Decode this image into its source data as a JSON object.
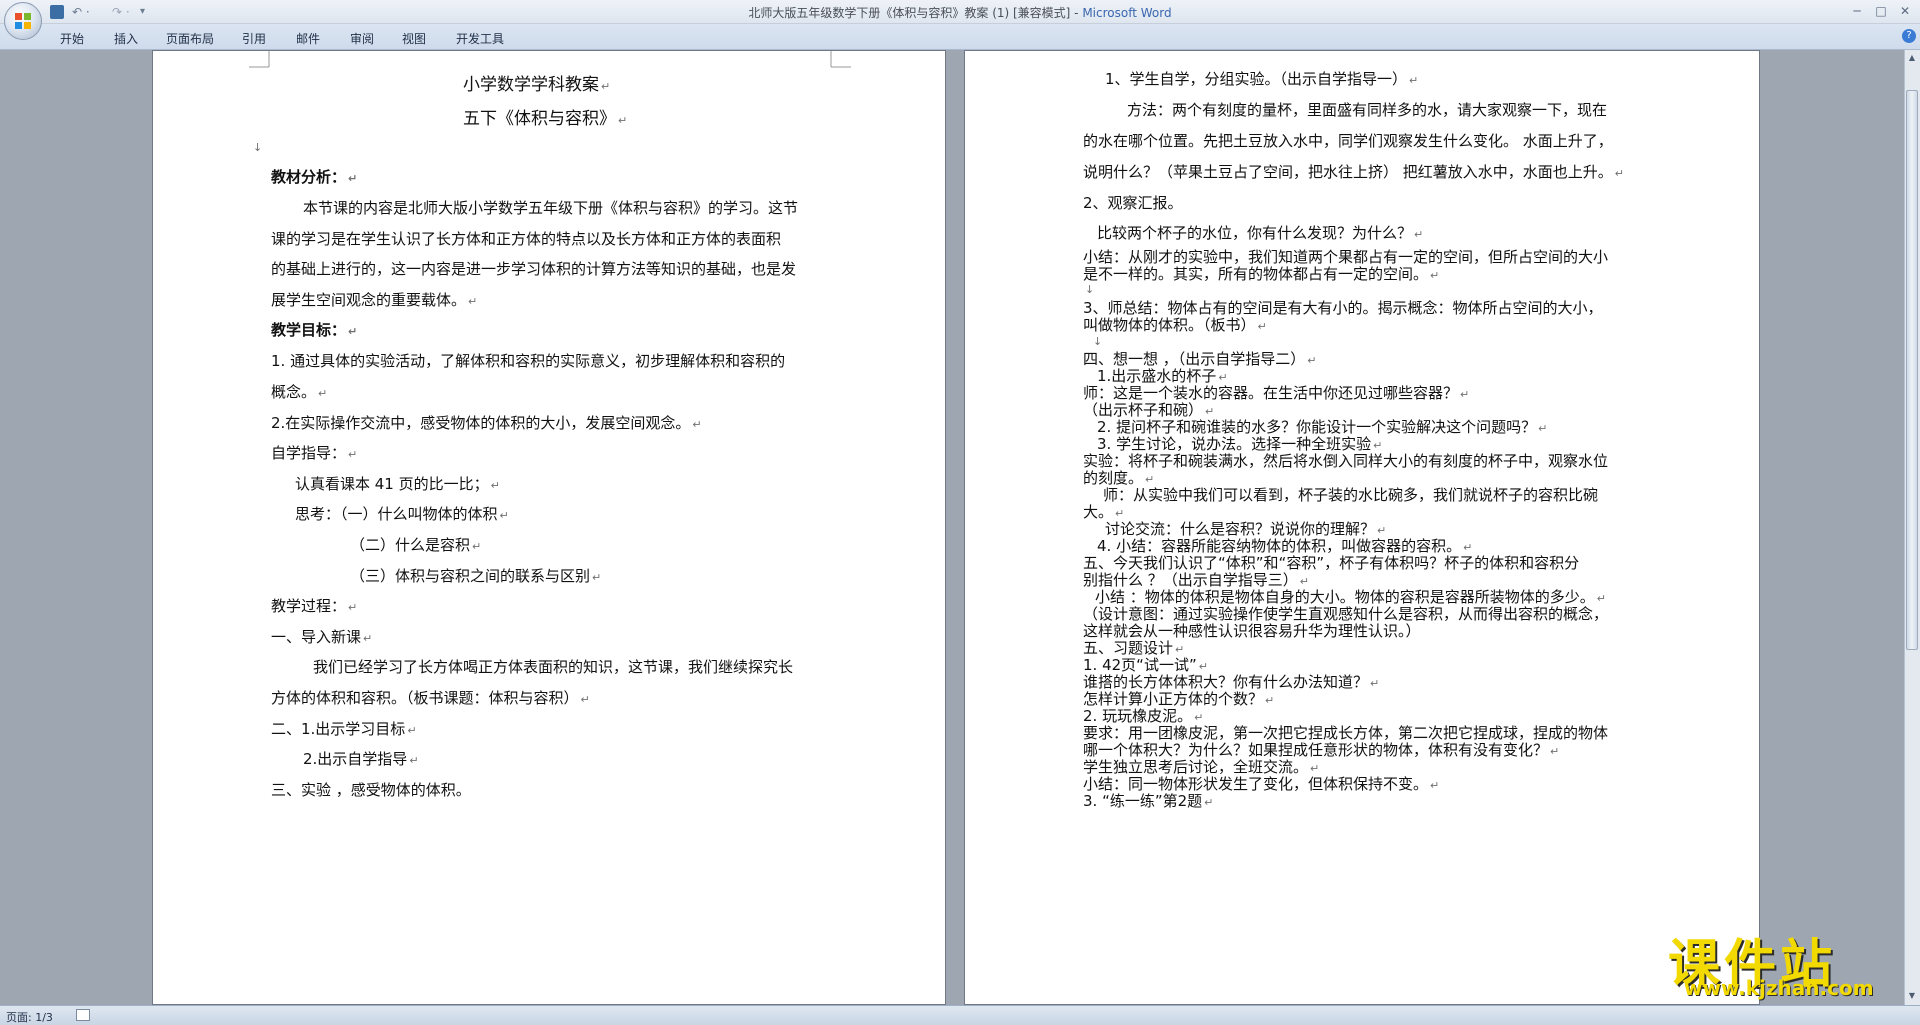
{
  "window": {
    "title_doc": "北师大版五年级数学下册《体积与容积》教案 (1) [兼容模式] - ",
    "title_app": "Microsoft Word"
  },
  "quick_access": {
    "undo": "↶ ·",
    "redo": "↷ ·",
    "more": "▾"
  },
  "ribbon": {
    "tabs": [
      "开始",
      "插入",
      "页面布局",
      "引用",
      "邮件",
      "审阅",
      "视图",
      "开发工具"
    ]
  },
  "page1": {
    "lines": [
      "小学数学学科教案",
      "五下《体积与容积》",
      "",
      "教材分析：",
      "本节课的内容是北师大版小学数学五年级下册《体积与容积》的学习。这节",
      "课的学习是在学生认识了长方体和正方体的特点以及长方体和正方体的表面积",
      "的基础上进行的，这一内容是进一步学习体积的计算方法等知识的基础，也是发",
      "展学生空间观念的重要载体。",
      "教学目标：",
      "1. 通过具体的实验活动，了解体积和容积的实际意义，初步理解体积和容积的",
      "概念。",
      "2.在实际操作交流中，感受物体的体积的大小，发展空间观念。",
      "自学指导：",
      "认真看课本 41 页的比一比；",
      "思考：（一）什么叫物体的体积",
      "（二）什么是容积",
      "（三）体积与容积之间的联系与区别",
      "教学过程：",
      "一、导入新课",
      "我们已经学习了长方体喝正方体表面积的知识，这节课，我们继续探究长",
      "方体的体积和容积。（板书课题：体积与容积）",
      "二、1.出示学习目标",
      "2.出示自学指导",
      "三、实验 ，感受物体的体积。"
    ]
  },
  "page2": {
    "lines": [
      "1、学生自学，分组实验。（出示自学指导一）",
      "方法：两个有刻度的量杯，里面盛有同样多的水，请大家观察一下，现在",
      "的水在哪个位置。先把土豆放入水中，同学们观察发生什么变化。 水面上升了，",
      "说明什么？（苹果土豆占了空间，把水往上挤） 把红薯放入水中，水面也上升。",
      "2、观察汇报。",
      "比较两个杯子的水位，你有什么发现？为什么？",
      "小结：从刚才的实验中，我们知道两个果都占有一定的空间，但所占空间的大小",
      "是不一样的。其实，所有的物体都占有一定的空间。",
      "",
      "3、师总结：物体占有的空间是有大有小的。揭示概念：物体所占空间的大小，",
      "叫做物体的体积。（板书）",
      "",
      "四、想一想 ，（出示自学指导二）",
      "1.出示盛水的杯子",
      "师：这是一个装水的容器。在生活中你还见过哪些容器？",
      "（出示杯子和碗）",
      "2. 提问杯子和碗谁装的水多？你能设计一个实验解决这个问题吗？",
      "3. 学生讨论，说办法。选择一种全班实验",
      "实验：将杯子和碗装满水，然后将水倒入同样大小的有刻度的杯子中，观察水位",
      "的刻度。",
      "师：从实验中我们可以看到，杯子装的水比碗多，我们就说杯子的容积比碗",
      "大。",
      "讨论交流：什么是容积？说说你的理解？",
      "4. 小结：容器所能容纳物体的体积，叫做容器的容积。",
      "五、今天我们认识了“体积”和“容积”，杯子有体积吗？杯子的体积和容积分",
      "别指什么 ？（出示自学指导三）",
      "小结 ：物体的体积是物体自身的大小。物体的容积是容器所装物体的多少。",
      "（设计意图：通过实验操作使学生直观感知什么是容积，从而得出容积的概念，",
      "这样就会从一种感性认识很容易升华为理性认识。）",
      "五、习题设计",
      "1. 42页“试一试”",
      "谁搭的长方体体积大？你有什么办法知道？",
      "怎样计算小正方体的个数？",
      "2. 玩玩橡皮泥。",
      "要求：用一团橡皮泥，第一次把它捏成长方体，第二次把它捏成球，捏成的物体",
      "哪一个体积大？为什么？如果捏成任意形状的物体，体积有没有变化？",
      "学生独立思考后讨论，全班交流。",
      "小结：同一物体形状发生了变化，但体积保持不变。",
      "3. “练一练”第2题"
    ]
  },
  "paragraph_mark": "↵",
  "arrow_mark": "↓",
  "status": {
    "page": "页面: 1/3"
  },
  "watermark": {
    "cn": "课件站",
    "url": "www.kjzhan.com"
  }
}
